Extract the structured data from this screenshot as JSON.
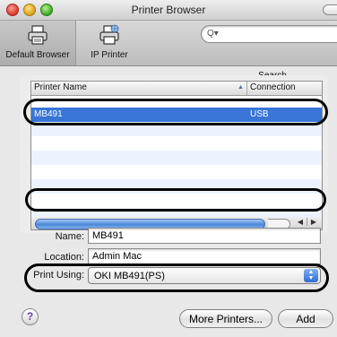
{
  "window": {
    "title": "Printer Browser"
  },
  "toolbar": {
    "default_browser_label": "Default Browser",
    "ip_printer_label": "IP Printer",
    "search_label": "Search",
    "search_placeholder": ""
  },
  "printer_list": {
    "columns": {
      "name": "Printer Name",
      "connection": "Connection"
    },
    "rows": [
      {
        "name": "MB491",
        "connection": "USB",
        "selected": true
      }
    ]
  },
  "details": {
    "name_label": "Name:",
    "name_value": "MB491",
    "location_label": "Location:",
    "location_value": "Admin Mac",
    "print_using_label": "Print Using:",
    "print_using_value": "OKI MB491(PS)"
  },
  "buttons": {
    "help": "?",
    "more_printers": "More Printers...",
    "add": "Add"
  },
  "colors": {
    "selection": "#3875d7",
    "highlight_outline": "#000000"
  }
}
